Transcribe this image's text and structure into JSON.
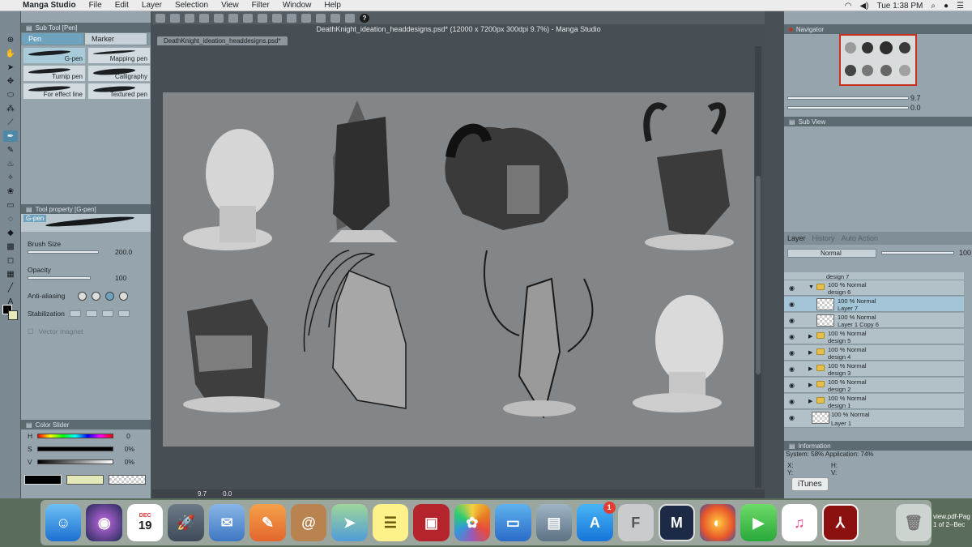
{
  "menubar": {
    "app_name": "Manga Studio",
    "items": [
      "File",
      "Edit",
      "Layer",
      "Selection",
      "View",
      "Filter",
      "Window",
      "Help"
    ],
    "clock": "Tue 1:38 PM"
  },
  "document": {
    "title": "DeathKnight_ideation_headdesigns.psd* (12000 x 7200px 300dpi 9.7%)  - Manga Studio",
    "tab": "DeathKnight_ideation_headdesigns.psd*",
    "zoom": "9.7",
    "angle": "0.0"
  },
  "subtool": {
    "panel_title": "Sub Tool [Pen]",
    "tabs": [
      "Pen",
      "Marker"
    ],
    "brushes": [
      "G-pen",
      "Mapping pen",
      "Turnip pen",
      "Calligraphy",
      "For effect line",
      "Textured pen"
    ]
  },
  "tool_property": {
    "panel_title": "Tool property [G-pen]",
    "brush_name": "G-pen",
    "brush_size_label": "Brush Size",
    "brush_size_value": "200.0",
    "opacity_label": "Opacity",
    "opacity_value": "100",
    "antialias_label": "Anti-aliasing",
    "stabilization_label": "Stabilization",
    "vector_magnet_label": "Vector magnet"
  },
  "color_slider": {
    "panel_title": "Color Slider",
    "h_label": "H",
    "h_value": "0",
    "s_label": "S",
    "s_value": "0%",
    "v_label": "V",
    "v_value": "0%"
  },
  "navigator": {
    "panel_title": "Navigator",
    "zoom_value": "9.7",
    "angle_value": "0.0",
    "subview_title": "Sub View"
  },
  "layers": {
    "tabs": [
      "Layer",
      "History",
      "Auto Action"
    ],
    "blend_mode": "Normal",
    "opacity": "100",
    "rows": [
      {
        "l1": "design 7",
        "l2": "",
        "type": "folder-partial"
      },
      {
        "l1": "100 % Normal",
        "l2": "design 6",
        "type": "folder-open"
      },
      {
        "l1": "100 % Normal",
        "l2": "Layer 7",
        "type": "layer",
        "selected": true
      },
      {
        "l1": "100 % Normal",
        "l2": "Layer 1 Copy 6",
        "type": "layer"
      },
      {
        "l1": "100 % Normal",
        "l2": "design 5",
        "type": "folder"
      },
      {
        "l1": "100 % Normal",
        "l2": "design 4",
        "type": "folder"
      },
      {
        "l1": "100 % Normal",
        "l2": "design 3",
        "type": "folder"
      },
      {
        "l1": "100 % Normal",
        "l2": "design 2",
        "type": "folder"
      },
      {
        "l1": "100 % Normal",
        "l2": "design 1",
        "type": "folder"
      },
      {
        "l1": "100 % Normal",
        "l2": "Layer 1",
        "type": "layer-base"
      }
    ]
  },
  "information": {
    "panel_title": "Information",
    "system_text": "System: 58% Application: 74%",
    "x_label": "X:",
    "y_label": "Y:",
    "h_label": "H:",
    "v_label": "V:"
  },
  "dock": {
    "tooltip": "iTunes",
    "calendar_month": "DEC",
    "calendar_day": "19",
    "appstore_badge": "1",
    "items": [
      "finder",
      "siri",
      "calendar",
      "launchpad",
      "mail",
      "pages",
      "contacts",
      "maps",
      "notes",
      "photo-booth",
      "photos",
      "keynote",
      "preview",
      "app-store",
      "fontlab",
      "manga-studio",
      "firefox",
      "facetime",
      "itunes",
      "acrobat",
      "trash"
    ]
  },
  "desktop_snippet": [
    "view.pdf-Pag",
    "1 of 2--Bec"
  ],
  "colors": {
    "accent": "#6fa2bd",
    "panel": "#95a4ad",
    "canvas_bg": "#838688",
    "close_red": "#c8301e"
  }
}
